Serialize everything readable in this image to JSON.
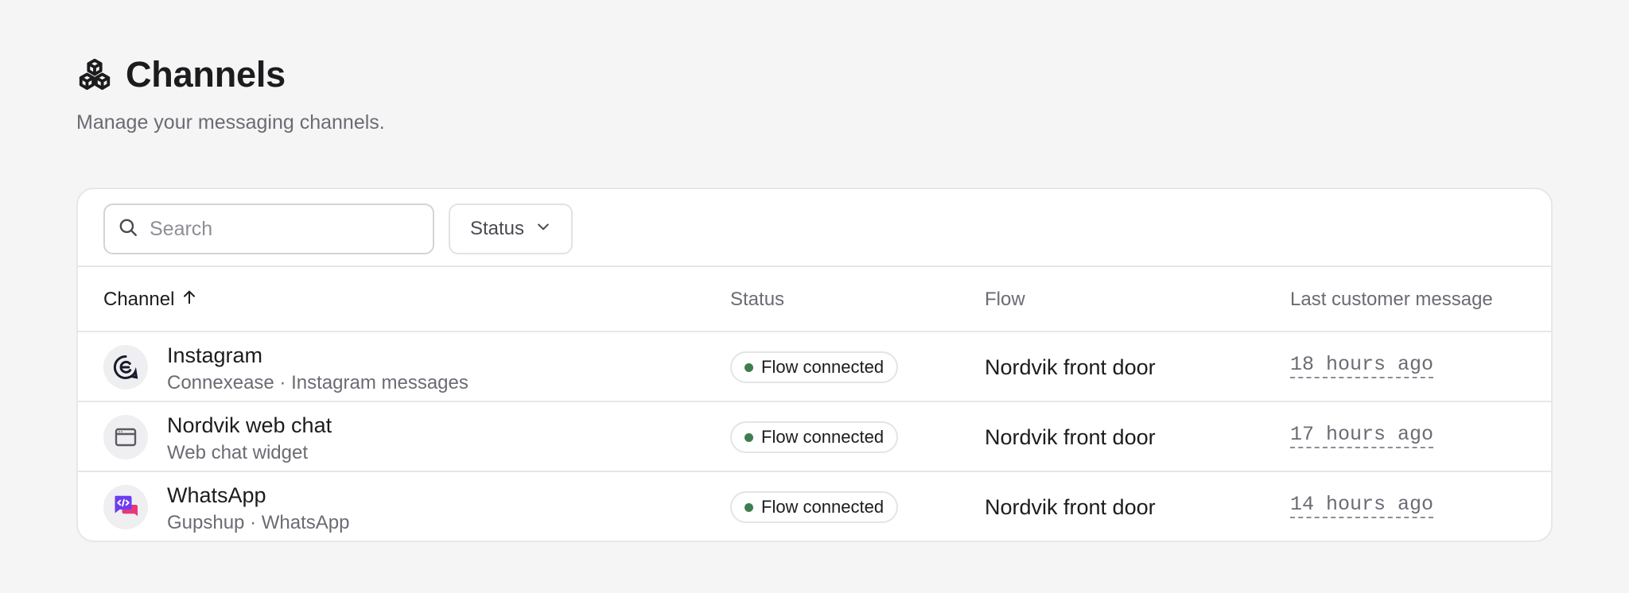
{
  "header": {
    "title": "Channels",
    "subtitle": "Manage your messaging channels."
  },
  "toolbar": {
    "search_placeholder": "Search",
    "status_filter_label": "Status"
  },
  "table": {
    "columns": {
      "channel": "Channel",
      "status": "Status",
      "flow": "Flow",
      "last_message": "Last customer message"
    },
    "rows": [
      {
        "name": "Instagram",
        "subtitle": "Connexease · Instagram messages",
        "icon": "instagram-connexease-icon",
        "status": "Flow connected",
        "flow": "Nordvik front door",
        "last_message": "18 hours ago"
      },
      {
        "name": "Nordvik web chat",
        "subtitle": "Web chat widget",
        "icon": "browser-window-icon",
        "status": "Flow connected",
        "flow": "Nordvik front door",
        "last_message": "17 hours ago"
      },
      {
        "name": "WhatsApp",
        "subtitle": "Gupshup · WhatsApp",
        "icon": "whatsapp-gupshup-icon",
        "status": "Flow connected",
        "flow": "Nordvik front door",
        "last_message": "14 hours ago"
      }
    ]
  },
  "colors": {
    "background": "#f5f5f5",
    "status_dot": "#3f7d4e",
    "gupshup_purple": "#6d3df0",
    "gupshup_pink": "#e8367a"
  }
}
